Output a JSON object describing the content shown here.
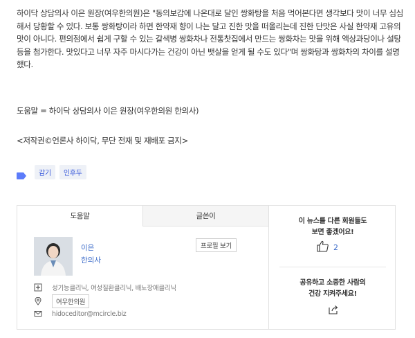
{
  "article": {
    "paragraph": "하이닥 상담의사 이은 원장(여우한의원)은 \"동의보감에 나온대로 달인 쌍화탕을 처음 먹어본다면 생각보다 맛이 너무 심심해서 당황할 수 있다. 보통 쌍화탕이라 하면 한약재 향이 나는 달고 진한 맛을 떠올리는데 진한 단맛은 사실 한약재 고유의 맛이 아니다. 편의점에서 쉽게 구할 수 있는 갈색병 쌍화차나 전통찻집에서 만드는 쌍화차는 맛을 위해 액상과당이나 설탕 등을 첨가한다. 맛있다고 너무 자주 마시다가는 건강이 아닌 뱃살을 얻게 될 수도 있다\"며 쌍화탕과 쌍화차의 차이를 설명했다.",
    "credit": "도움말 = 하이닥 상담의사 이은 원장(여우한의원 한의사)",
    "copyright": "<저작권©언론사 하이닥, 무단 전재 및 재배포 금지>"
  },
  "tags": [
    "감기",
    "인후두"
  ],
  "panel": {
    "tabs": [
      {
        "label": "도움말"
      },
      {
        "label": "글쓴이"
      }
    ],
    "doctor_name": "이은",
    "doctor_role": "한의사",
    "profile_button": "프로필 보기",
    "specialties": "성기능클리닉, 여성질환클리닉, 배뇨장애클리닉",
    "hospital": "여우한의원",
    "email": "hidoceditor@mcircle.biz",
    "recommend_text_1": "이 뉴스를 다른 회원들도",
    "recommend_text_2": "보면 좋겠어요!",
    "like_count": "2",
    "share_text_1": "공유하고 소중한 사람의",
    "share_text_2": "건강 지켜주세요!"
  },
  "colors": {
    "accent": "#3b6bc9",
    "tag_bg": "#eef1f7",
    "border": "#e1e1e1"
  }
}
